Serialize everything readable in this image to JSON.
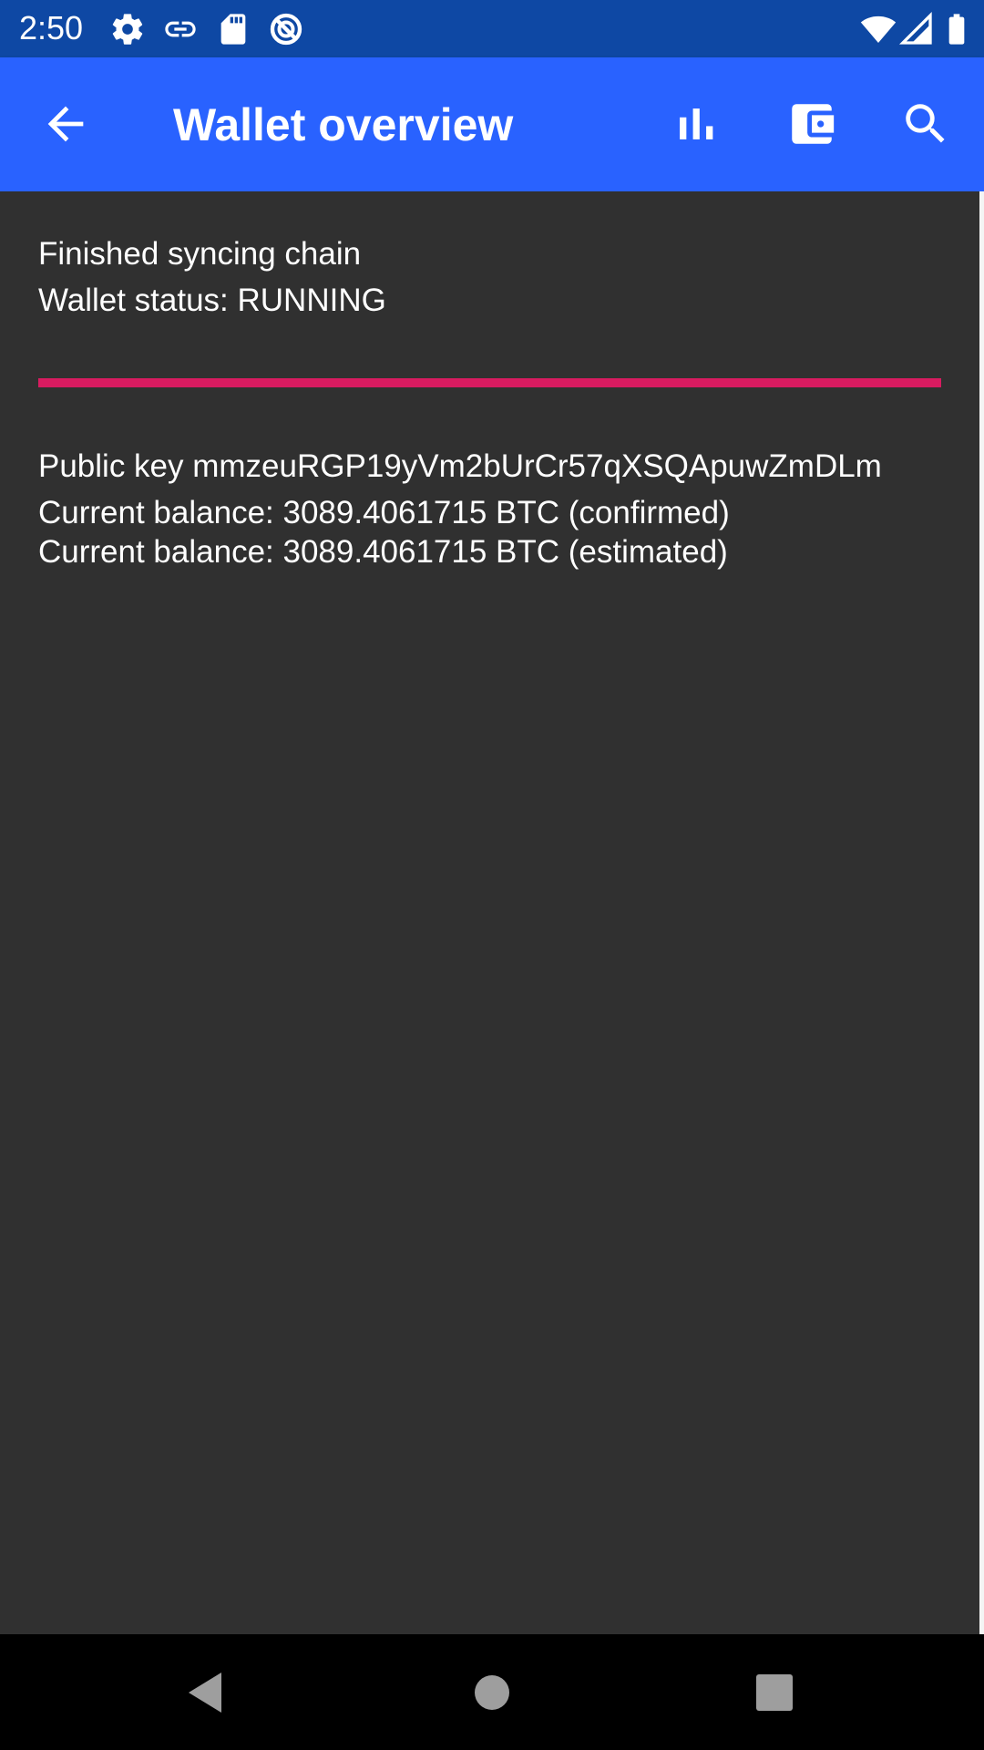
{
  "status_bar": {
    "time": "2:50",
    "left_icons": [
      "settings-gear-icon",
      "link-icon",
      "sd-card-icon",
      "no-disturb-icon"
    ],
    "right_icons": [
      "wifi-icon",
      "cell-signal-icon",
      "battery-icon"
    ],
    "background_color": "#0e48a4"
  },
  "app_bar": {
    "title": "Wallet overview",
    "background_color": "#2962ff",
    "actions": [
      "bar-chart-icon",
      "wallet-icon",
      "search-icon"
    ]
  },
  "sync": {
    "status_line": "Finished syncing chain",
    "wallet_status": "Wallet status: RUNNING",
    "progress": 1.0,
    "progress_color": "#d81b60"
  },
  "wallet": {
    "public_key_line": "Public key mmzeuRGP19yVm2bUrCr57qXSQApuwZmDLm",
    "balance_confirmed": "Current balance: 3089.4061715 BTC (confirmed)",
    "balance_estimated": "Current balance: 3089.4061715 BTC (estimated)"
  },
  "nav_bar": {
    "buttons": [
      "back-triangle-icon",
      "home-circle-icon",
      "recents-square-icon"
    ]
  },
  "colors": {
    "content_background": "#303030",
    "text": "#ffffff"
  }
}
